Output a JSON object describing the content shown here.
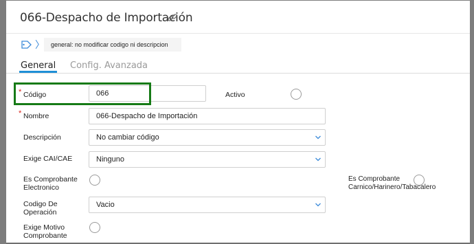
{
  "header": {
    "title": "066-Despacho de Importación",
    "link_icon": "link-icon"
  },
  "breadcrumb": {
    "tag_icon": "tag-icon",
    "chevron": "〉",
    "note": "general: no modificar codigo ni descripcion"
  },
  "tabs": [
    {
      "label": "General",
      "active": true
    },
    {
      "label": "Config. Avanzada",
      "active": false
    }
  ],
  "form": {
    "codigo": {
      "label": "Código",
      "value": "066",
      "required": true
    },
    "activo": {
      "label": "Activo",
      "checked": false
    },
    "nombre": {
      "label": "Nombre",
      "value": "066-Despacho de Importación",
      "required": true
    },
    "descripcion": {
      "label": "Descripción",
      "value": "No cambiar código"
    },
    "exige_cai": {
      "label": "Exige CAI/CAE",
      "value": "Ninguno"
    },
    "es_electronico": {
      "label": "Es Comprobante Electronico",
      "checked": false
    },
    "es_carnico": {
      "label": "Es Comprobante Carnico/Harinero/Tabacalero",
      "checked": false
    },
    "codigo_operacion": {
      "label": "Codigo De Operación",
      "value": "Vacio"
    },
    "exige_motivo": {
      "label": "Exige Motivo Comprobante",
      "checked": false
    }
  },
  "colors": {
    "accent": "#1f8fd6",
    "highlight": "#167a16",
    "required": "#d9261c"
  }
}
